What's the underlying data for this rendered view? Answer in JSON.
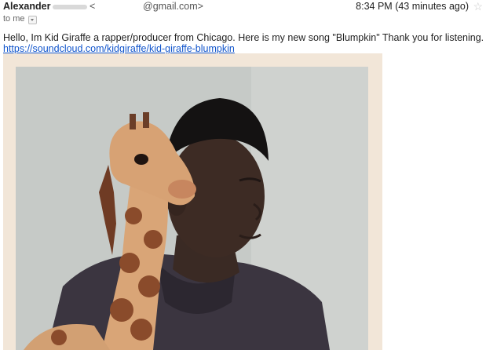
{
  "email": {
    "sender_name": "Alexander",
    "sender_bracket": "<",
    "sender_email_domain": "@gmail.com>",
    "time": "8:34 PM (43 minutes ago)",
    "to": "to me",
    "body_line": "Hello, Im Kid Giraffe a rapper/producer from Chicago. Here is my new song \"Blumpkin\" Thank you for listening.",
    "link": "https://soundcloud.com/kidgiraffe/kid-giraffe-blumpkin"
  },
  "icons": {
    "star": "star-icon",
    "dropdown": "chevron-down-icon"
  },
  "colors": {
    "link": "#1155cc",
    "star": "#c9c9c9",
    "frame": "#f2e6d8"
  }
}
